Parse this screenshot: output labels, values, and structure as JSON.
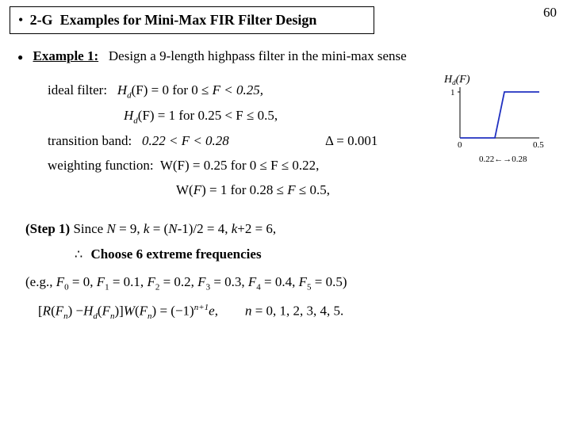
{
  "page_number": "60",
  "title_prefix": "2-G",
  "title_text": "Examples for Mini-Max FIR Filter Design",
  "example_label": "Example 1:",
  "example_desc": "Design a 9-length highpass filter in the mini-max sense",
  "ideal": {
    "prefix": "ideal filter:",
    "l1_a": "H",
    "l1_sub": "d",
    "l1_b": "(F) = 0 for  0 ",
    "l1_op": "≤",
    "l1_c": " F < 0.25,",
    "l2_a": "H",
    "l2_sub": "d",
    "l2_b": "(F) = 1 for  0.25 < F ",
    "l2_op": "≤",
    "l2_c": " 0.5,"
  },
  "transition": {
    "prefix": "transition band:",
    "range": "0.22 < F < 0.28",
    "delta_sym": "Δ",
    "delta_val": " = 0.001"
  },
  "weight": {
    "prefix": "weighting function:",
    "l1": "W(F) = 0.25 for 0 ≤ F ≤ 0.22,",
    "l2": "W(F) = 1 for 0.28 ≤ F ≤ 0.5,"
  },
  "step1": {
    "head": "(Step 1)",
    "body": "Since N = 9, k = (N-1)/2 = 4, k+2 = 6,",
    "arrow_text": "Choose 6 extreme frequencies"
  },
  "eg": "(e.g., F₀ = 0, F₁ = 0.1, F₂ = 0.2, F₃ = 0.3, F₄ = 0.4, F₅ = 0.5)",
  "eq": {
    "open": "[",
    "R": "R",
    "Fa": "(F",
    "n": "n",
    "close1": ") −",
    "Hd": "H",
    "d": "d",
    "Fb": "(F",
    "close2": ")]",
    "W": "W",
    "Fc": "(F",
    "eqd": ") = (−1)",
    "exp": "n+1",
    "e": "e,",
    "rhs": "n = 0, 1, 2, 3, 4, 5."
  },
  "chart_data": {
    "type": "line",
    "title": "",
    "xlabel": "",
    "ylabel": "Hd(F)",
    "x_ticks": [
      "0",
      "0.5"
    ],
    "y_ticks": [
      "0",
      "1"
    ],
    "transition_label": "0.22←→0.28",
    "series": [
      {
        "name": "ideal highpass",
        "x": [
          0,
          0.22,
          0.22,
          0.28,
          0.28,
          0.5
        ],
        "y": [
          0,
          0,
          0,
          1,
          1,
          1
        ]
      }
    ],
    "xlim": [
      0,
      0.5
    ],
    "ylim": [
      0,
      1
    ]
  }
}
